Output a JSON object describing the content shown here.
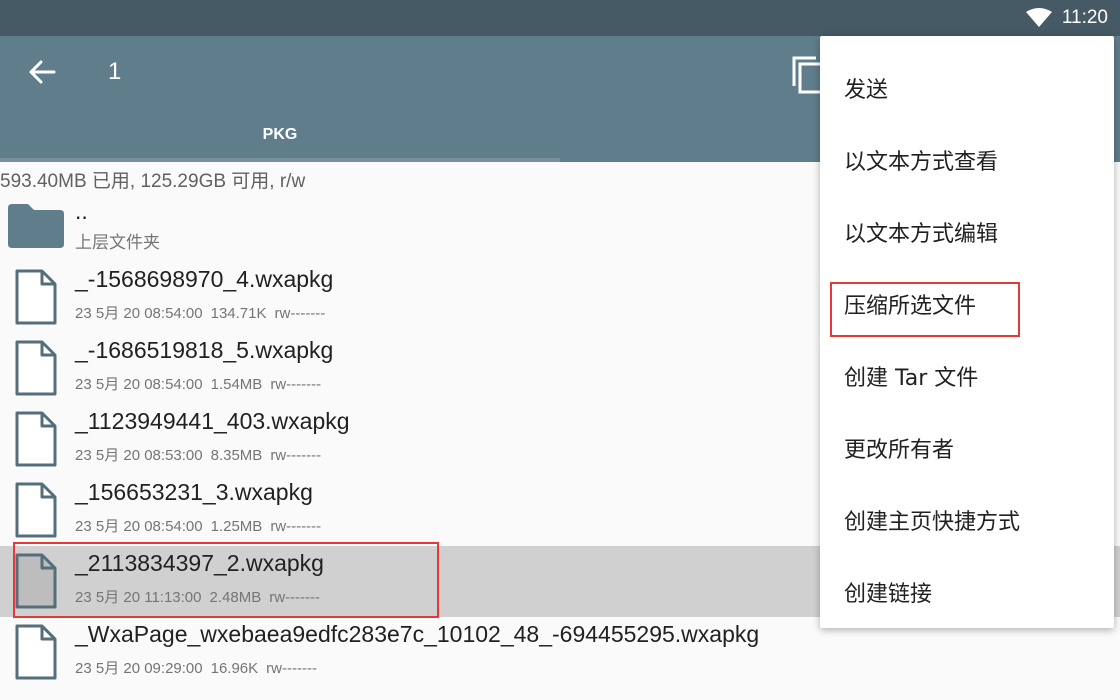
{
  "status": {
    "time": "11:20"
  },
  "appbar": {
    "title": "1",
    "tab_label": "PKG"
  },
  "storage": {
    "info": "593.40MB 已用, 125.29GB 可用, r/w"
  },
  "parent": {
    "name": "..",
    "label": "上层文件夹"
  },
  "files": [
    {
      "name": "_-1568698970_4.wxapkg",
      "date": "23 5月 20 08:54:00",
      "size": "134.71K",
      "perm": "rw-------"
    },
    {
      "name": "_-1686519818_5.wxapkg",
      "date": "23 5月 20 08:54:00",
      "size": "1.54MB",
      "perm": "rw-------"
    },
    {
      "name": "_1123949441_403.wxapkg",
      "date": "23 5月 20 08:53:00",
      "size": "8.35MB",
      "perm": "rw-------"
    },
    {
      "name": "_156653231_3.wxapkg",
      "date": "23 5月 20 08:54:00",
      "size": "1.25MB",
      "perm": "rw-------"
    },
    {
      "name": "_2113834397_2.wxapkg",
      "date": "23 5月 20 11:13:00",
      "size": "2.48MB",
      "perm": "rw-------"
    },
    {
      "name": "_WxaPage_wxebaea9edfc283e7c_10102_48_-694455295.wxapkg",
      "date": "23 5月 20 09:29:00",
      "size": "16.96K",
      "perm": "rw-------"
    }
  ],
  "menu": {
    "items": [
      {
        "label": "发送"
      },
      {
        "label": "以文本方式查看"
      },
      {
        "label": "以文本方式编辑"
      },
      {
        "label": "压缩所选文件"
      },
      {
        "label": "创建 Tar 文件"
      },
      {
        "label": "更改所有者"
      },
      {
        "label": "创建主页快捷方式"
      },
      {
        "label": "创建链接"
      }
    ]
  },
  "colors": {
    "statusbar": "#455a64",
    "appbar": "#607d8b",
    "highlight": "#e53935",
    "selected_row": "#d0d0d0"
  },
  "icons": [
    "wifi-icon",
    "back-arrow-icon",
    "copy-icon",
    "folder-icon",
    "file-icon"
  ]
}
